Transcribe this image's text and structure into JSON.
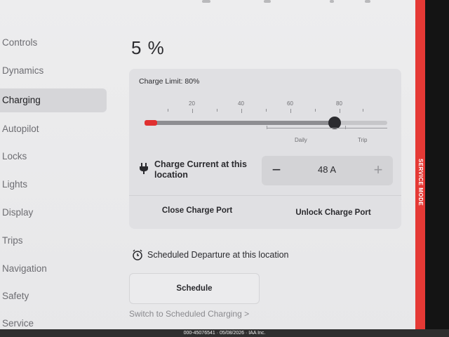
{
  "nav": {
    "items": [
      {
        "label": "Controls",
        "active": false
      },
      {
        "label": "Dynamics",
        "active": false
      },
      {
        "label": "Charging",
        "active": true
      },
      {
        "label": "Autopilot",
        "active": false
      },
      {
        "label": "Locks",
        "active": false
      },
      {
        "label": "Lights",
        "active": false
      },
      {
        "label": "Display",
        "active": false
      },
      {
        "label": "Trips",
        "active": false
      },
      {
        "label": "Navigation",
        "active": false
      },
      {
        "label": "Safety",
        "active": false
      },
      {
        "label": "Service",
        "active": false
      }
    ]
  },
  "battery": {
    "percent_label": "5 %",
    "level": 5
  },
  "charging": {
    "limit_label": "Charge Limit: 80%",
    "limit_value": 80,
    "scale_labels": [
      "20",
      "40",
      "60",
      "80"
    ],
    "range_labels": {
      "daily": "Daily",
      "trip": "Trip"
    },
    "current_label": "Charge Current at this location",
    "current_value": "48 A",
    "minus_label": "−",
    "plus_label": "+",
    "close_port_label": "Close Charge Port",
    "unlock_port_label": "Unlock Charge Port"
  },
  "schedule": {
    "departure_label": "Scheduled Departure at this location",
    "button_label": "Schedule",
    "switch_link": "Switch to Scheduled Charging >"
  },
  "service_mode": "SERVICE MODE",
  "footer": {
    "watermark": "000-45076541 · 05/08/2026 · IAA Inc."
  },
  "colors": {
    "service_red": "#e53935",
    "level_red": "#e03030",
    "accent_dark": "#2b2b2f"
  }
}
